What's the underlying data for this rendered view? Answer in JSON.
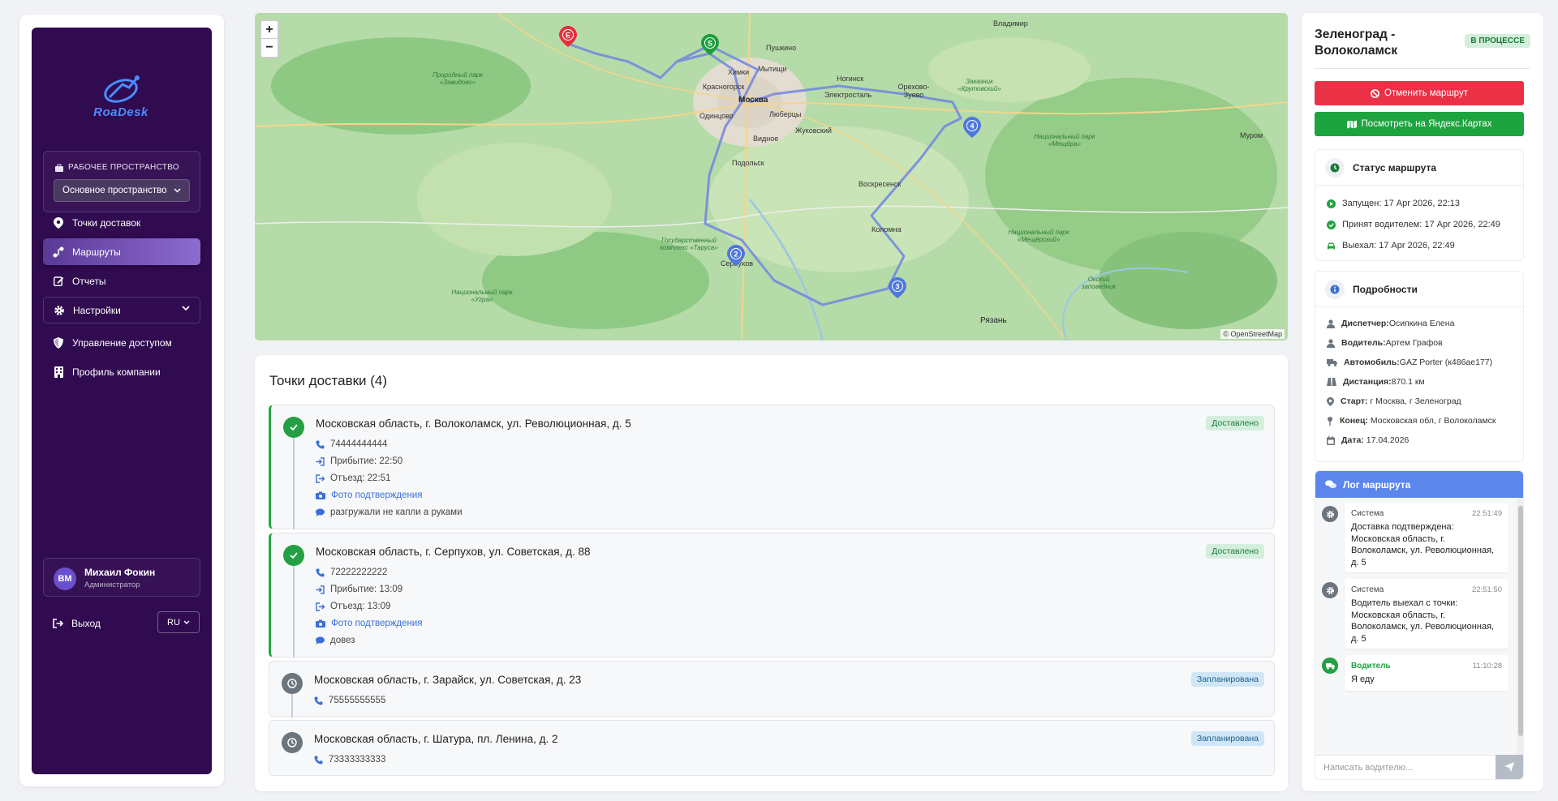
{
  "app": {
    "logo_text": "RoaDesk"
  },
  "sidebar": {
    "workspace_label": "РАБОЧЕЕ ПРОСТРАНСТВО",
    "workspace_value": "Основное пространство",
    "items": [
      {
        "label": "Точки доставок",
        "icon": "map-pin-icon"
      },
      {
        "label": "Маршруты",
        "icon": "route-icon",
        "active": true
      },
      {
        "label": "Отчеты",
        "icon": "edit-icon"
      },
      {
        "label": "Настройки",
        "icon": "gear-icon"
      },
      {
        "label": "Управление доступом",
        "icon": "shield-icon"
      },
      {
        "label": "Профиль компании",
        "icon": "building-icon"
      }
    ],
    "user": {
      "initials": "ВМ",
      "name": "Михаил Фокин",
      "role": "Администратор"
    },
    "logout_label": "Выход",
    "language": "RU"
  },
  "map": {
    "zoom_in": "+",
    "zoom_out": "−",
    "attribution": "© OpenStreetMap",
    "labels": {
      "vladimir": "Владимир",
      "pushkino": "Пушкино",
      "khimki": "Химки",
      "mytishchi": "Мытищи",
      "krasnogorsk": "Красногорск",
      "moscow": "Москва",
      "noginsk": "Ногинск",
      "elektrostal": "Электросталь",
      "orekhovo": "Орехово-Зуево",
      "odintsovo": "Одинцово",
      "lyubertsy": "Люберцы",
      "zhukovsky": "Жуковский",
      "vidnoe": "Видное",
      "podolsk": "Подольск",
      "voskresensk": "Воскресенск",
      "kolomna": "Коломна",
      "serpukhov": "Серпухов",
      "ryazan": "Рязань",
      "murom": "Муром",
      "park_zavidovo": "Природный парк «Завидово»",
      "zakaznik": "Заказник «Крутовский»",
      "park_meshchera": "Национальный парк «Мещёра»",
      "park_meshchersky": "Национальный парк «Мещёрский»",
      "zapovednik_taruza": "Государственный комплекс «Таруса»",
      "park_ugra": "Национальный парк «Угра»",
      "oksky": "Окский заповедник"
    },
    "markers": [
      {
        "label": "E",
        "color": "#e6303c"
      },
      {
        "label": "S",
        "color": "#1e9e3e"
      },
      {
        "label": "2",
        "color": "#4f78e0"
      },
      {
        "label": "3",
        "color": "#4f78e0"
      },
      {
        "label": "4",
        "color": "#4f78e0"
      }
    ]
  },
  "points": {
    "title": "Точки доставки (4)",
    "items": [
      {
        "address": "Московская область, г. Волоколамск, ул. Революционная, д. 5",
        "status": "Доставлено",
        "phone": "74444444444",
        "arrival": "Прибытие: 22:50",
        "departure": "Отъезд: 22:51",
        "photo": "Фото подтверждения",
        "comment": "разгружали не капли а руками"
      },
      {
        "address": "Московская область, г. Серпухов, ул. Советская, д. 88",
        "status": "Доставлено",
        "phone": "72222222222",
        "arrival": "Прибытие: 13:09",
        "departure": "Отъезд: 13:09",
        "photo": "Фото подтверждения",
        "comment": "довез"
      },
      {
        "address": "Московская область, г. Зарайск, ул. Советская, д. 23",
        "status": "Запланирована",
        "phone": "75555555555"
      },
      {
        "address": "Московская область, г. Шатура, пл. Ленина, д. 2",
        "status": "Запланирована",
        "phone": "73333333333"
      }
    ]
  },
  "route": {
    "title": "Зеленоград - Волоколамск",
    "status": "В ПРОЦЕССЕ",
    "cancel_label": "Отменить маршрут",
    "yandex_label": "Посмотреть на Яндекс.Картах",
    "status_card": {
      "title": "Статус маршрута",
      "started": "Запущен: 17 Apr 2026, 22:13",
      "accepted": "Принят водителем: 17 Apr 2026, 22:49",
      "departed": "Выехал: 17 Apr 2026, 22:49"
    },
    "details": {
      "title": "Подробности",
      "dispatcher_label": "Диспетчер:",
      "dispatcher": "Осипкина Елена",
      "driver_label": "Водитель:",
      "driver": "Артем Графов",
      "vehicle_label": "Автомобиль:",
      "vehicle": "GAZ Porter (к486ае177)",
      "distance_label": "Дистанция:",
      "distance": "870.1 км",
      "start_label": "Старт:",
      "start": "г Москва, г Зеленоград",
      "end_label": "Конец:",
      "end": "Московская обл, г Волоколамск",
      "date_label": "Дата:",
      "date": "17.04.2026"
    },
    "log": {
      "title": "Лог маршрута",
      "messages": [
        {
          "author": "Система",
          "time": "22:51:49",
          "text": "Доставка подтверждена: Московская область, г. Волоколамск, ул. Революционная, д. 5"
        },
        {
          "author": "Система",
          "time": "22:51:50",
          "text": "Водитель выехал с точки: Московская область, г. Волоколамск, ул. Революционная, д. 5"
        },
        {
          "author": "Водитель",
          "time": "11:10:28",
          "text": "Я еду"
        }
      ],
      "input_placeholder": "Написать водителю..."
    }
  }
}
